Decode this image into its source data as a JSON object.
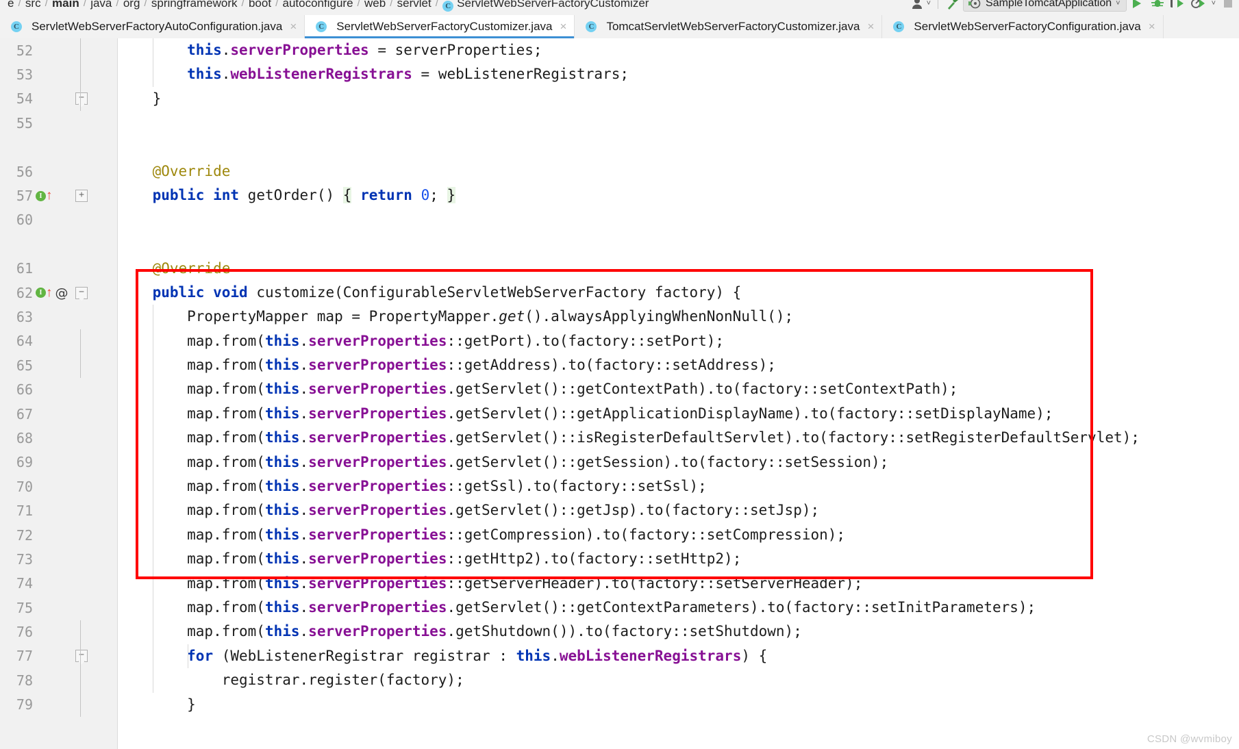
{
  "window": {
    "app": "IntelliJ IDEA",
    "watermark": "CSDN @wvmiboy"
  },
  "breadcrumb": {
    "items": [
      {
        "label": "e",
        "bold": false,
        "icon": ""
      },
      {
        "label": "src",
        "bold": false,
        "icon": ""
      },
      {
        "label": "main",
        "bold": true,
        "icon": ""
      },
      {
        "label": "java",
        "bold": false,
        "icon": ""
      },
      {
        "label": "org",
        "bold": false,
        "icon": ""
      },
      {
        "label": "springframework",
        "bold": false,
        "icon": ""
      },
      {
        "label": "boot",
        "bold": false,
        "icon": ""
      },
      {
        "label": "autoconfigure",
        "bold": false,
        "icon": ""
      },
      {
        "label": "web",
        "bold": false,
        "icon": ""
      },
      {
        "label": "servlet",
        "bold": false,
        "icon": ""
      },
      {
        "label": "ServletWebServerFactoryCustomizer",
        "bold": false,
        "icon": "java-class-icon"
      }
    ],
    "separator": "/"
  },
  "toolbar": {
    "avatar_icon": "user-avatar-icon",
    "avatar_caret": "˅",
    "hammer_icon": "build-hammer-icon",
    "run_config": {
      "icon": "spring-boot-run-config-icon",
      "label": "SampleTomcatApplication",
      "caret": "˅"
    },
    "run_icon": "run-play-icon",
    "debug_icon": "debug-bug-icon",
    "run_with_coverage_icon": "run-coverage-icon",
    "profile_icon": "profile-icon",
    "more_caret": "˅",
    "stop_icon": "stop-square-icon"
  },
  "tabs": [
    {
      "label": "ServletWebServerFactoryAutoConfiguration.java",
      "icon": "java-class-icon",
      "close": "×",
      "active": false
    },
    {
      "label": "ServletWebServerFactoryCustomizer.java",
      "icon": "java-class-icon",
      "close": "×",
      "active": true
    },
    {
      "label": "TomcatServletWebServerFactoryCustomizer.java",
      "icon": "java-class-icon",
      "close": "×",
      "active": false
    },
    {
      "label": "ServletWebServerFactoryConfiguration.java",
      "icon": "java-class-icon",
      "close": "×",
      "active": false
    }
  ],
  "editor": {
    "language": "java",
    "colors": {
      "keyword": "#0033b3",
      "field": "#871094",
      "annotation": "#9e880d",
      "number": "#1750eb",
      "text": "#1c1c1c",
      "background": "#ffffff",
      "gutter_background": "#f1f1f1",
      "line_number": "#999999",
      "highlight_box": "#ff0000",
      "tab_active_underline": "#3c8fd4",
      "brace_match": "#e8f5e4"
    },
    "annotation_box": {
      "shape": "rectangle",
      "color": "#ff0000",
      "covers_lines": "64-76"
    },
    "gutter": [
      {
        "num": "52",
        "marks": [],
        "fold": ""
      },
      {
        "num": "53",
        "marks": [],
        "fold": ""
      },
      {
        "num": "54",
        "marks": [],
        "fold": "minus"
      },
      {
        "num": "55",
        "marks": [],
        "fold": ""
      },
      {
        "num": "",
        "marks": [],
        "fold": ""
      },
      {
        "num": "56",
        "marks": [],
        "fold": ""
      },
      {
        "num": "57",
        "marks": [
          "override-impl-icon",
          "override-arrow-icon"
        ],
        "fold": "plus"
      },
      {
        "num": "60",
        "marks": [],
        "fold": ""
      },
      {
        "num": "",
        "marks": [],
        "fold": ""
      },
      {
        "num": "61",
        "marks": [],
        "fold": ""
      },
      {
        "num": "62",
        "marks": [
          "override-impl-icon",
          "override-arrow-icon",
          "annotation-at-icon"
        ],
        "fold": "minus"
      },
      {
        "num": "63",
        "marks": [],
        "fold": ""
      },
      {
        "num": "64",
        "marks": [],
        "fold": ""
      },
      {
        "num": "65",
        "marks": [],
        "fold": ""
      },
      {
        "num": "66",
        "marks": [],
        "fold": ""
      },
      {
        "num": "67",
        "marks": [],
        "fold": ""
      },
      {
        "num": "68",
        "marks": [],
        "fold": ""
      },
      {
        "num": "69",
        "marks": [],
        "fold": ""
      },
      {
        "num": "70",
        "marks": [],
        "fold": ""
      },
      {
        "num": "71",
        "marks": [],
        "fold": ""
      },
      {
        "num": "72",
        "marks": [],
        "fold": ""
      },
      {
        "num": "73",
        "marks": [],
        "fold": ""
      },
      {
        "num": "74",
        "marks": [],
        "fold": ""
      },
      {
        "num": "75",
        "marks": [],
        "fold": ""
      },
      {
        "num": "76",
        "marks": [],
        "fold": ""
      },
      {
        "num": "77",
        "marks": [],
        "fold": "minus"
      },
      {
        "num": "78",
        "marks": [],
        "fold": ""
      },
      {
        "num": "79",
        "marks": [],
        "fold": ""
      }
    ],
    "code_lines": [
      "        this.serverProperties = serverProperties;",
      "        this.webListenerRegistrars = webListenerRegistrars;",
      "    }",
      "",
      "",
      "    @Override",
      "    public int getOrder() { return 0; }",
      "",
      "",
      "    @Override",
      "    public void customize(ConfigurableServletWebServerFactory factory) {",
      "        PropertyMapper map = PropertyMapper.get().alwaysApplyingWhenNonNull();",
      "        map.from(this.serverProperties::getPort).to(factory::setPort);",
      "        map.from(this.serverProperties::getAddress).to(factory::setAddress);",
      "        map.from(this.serverProperties.getServlet()::getContextPath).to(factory::setContextPath);",
      "        map.from(this.serverProperties.getServlet()::getApplicationDisplayName).to(factory::setDisplayName);",
      "        map.from(this.serverProperties.getServlet()::isRegisterDefaultServlet).to(factory::setRegisterDefaultServlet);",
      "        map.from(this.serverProperties.getServlet()::getSession).to(factory::setSession);",
      "        map.from(this.serverProperties::getSsl).to(factory::setSsl);",
      "        map.from(this.serverProperties.getServlet()::getJsp).to(factory::setJsp);",
      "        map.from(this.serverProperties::getCompression).to(factory::setCompression);",
      "        map.from(this.serverProperties::getHttp2).to(factory::setHttp2);",
      "        map.from(this.serverProperties::getServerHeader).to(factory::setServerHeader);",
      "        map.from(this.serverProperties.getServlet()::getContextParameters).to(factory::setInitParameters);",
      "        map.from(this.serverProperties.getShutdown()).to(factory::setShutdown);",
      "        for (WebListenerRegistrar registrar : this.webListenerRegistrars) {",
      "            registrar.register(factory);",
      "        }"
    ]
  }
}
